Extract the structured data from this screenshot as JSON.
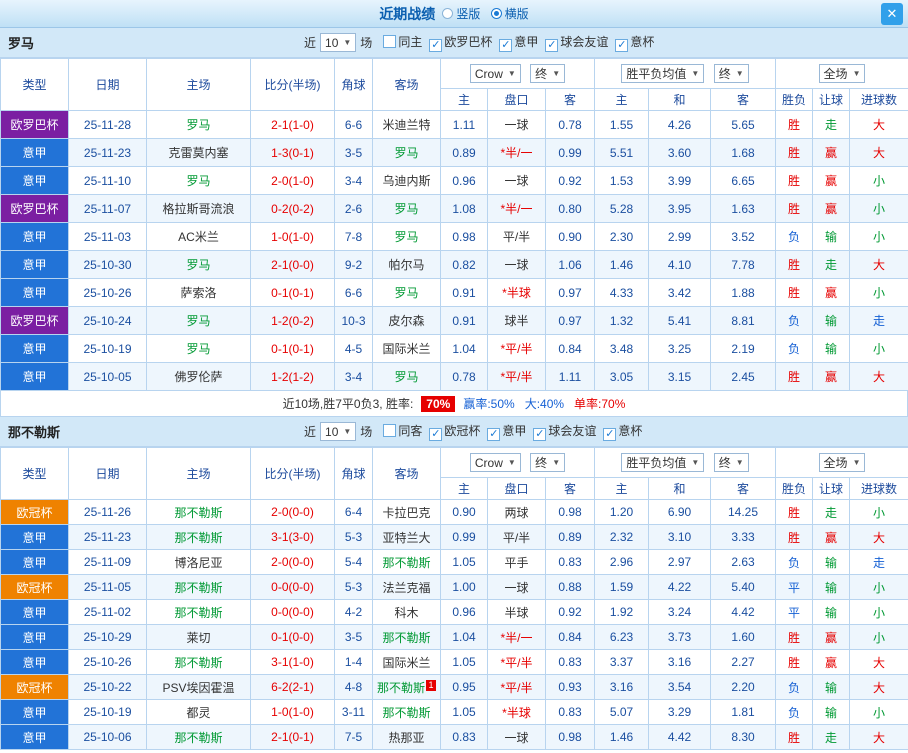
{
  "icons": {
    "dropdown_arrow": "▼",
    "check": "✓",
    "close": "✕"
  },
  "titlebar": {
    "title": "近期战绩",
    "radio_options": [
      {
        "label": "竖版",
        "selected": false
      },
      {
        "label": "横版",
        "selected": true
      }
    ]
  },
  "table_header": {
    "type": "类型",
    "date": "日期",
    "home": "主场",
    "score": "比分(半场)",
    "corner": "角球",
    "away": "客场",
    "odds_source_select": "Crow",
    "odds_time_select": "终",
    "odds_subs": [
      "主",
      "盘口",
      "客"
    ],
    "europe_select": "胜平负均值",
    "europe_time_select": "终",
    "europe_subs": [
      "主",
      "和",
      "客"
    ],
    "result_select": "全场",
    "result_subs": [
      "胜负",
      "让球",
      "进球数"
    ]
  },
  "type_colors": {
    "purple": "#7b1fa2",
    "blue": "#2273d7",
    "orange": "#ef8200"
  },
  "status_colors": {
    "red": "#e60000",
    "green": "#009933",
    "blue": "#1560d4"
  },
  "sections": [
    {
      "team": "罗马",
      "near_label": "近",
      "count_select": "10",
      "count_suffix": "场",
      "filters": [
        {
          "label": "同主",
          "checked": false
        },
        {
          "label": "欧罗巴杯",
          "checked": true
        },
        {
          "label": "意甲",
          "checked": true
        },
        {
          "label": "球会友谊",
          "checked": true
        },
        {
          "label": "意杯",
          "checked": true
        }
      ],
      "rows": [
        {
          "type": "欧罗巴杯",
          "type_color": "purple",
          "date": "25-11-28",
          "home": "罗马",
          "home_subject": true,
          "score": "2-1(1-0)",
          "corner": "6-6",
          "away": "米迪兰特",
          "odds_home": "1.11",
          "handicap": "一球",
          "handicap_red": false,
          "odds_away": "0.78",
          "eu_home": "1.55",
          "eu_draw": "4.26",
          "eu_away": "5.65",
          "results": [
            [
              "胜",
              "red"
            ],
            [
              "走",
              "green"
            ],
            [
              "大",
              "red"
            ]
          ]
        },
        {
          "type": "意甲",
          "type_color": "blue",
          "date": "25-11-23",
          "home": "克雷莫内塞",
          "score": "1-3(0-1)",
          "corner": "3-5",
          "away": "罗马",
          "away_subject": true,
          "odds_home": "0.89",
          "handicap": "*半/一",
          "handicap_red": true,
          "odds_away": "0.99",
          "eu_home": "5.51",
          "eu_draw": "3.60",
          "eu_away": "1.68",
          "results": [
            [
              "胜",
              "red"
            ],
            [
              "赢",
              "red"
            ],
            [
              "大",
              "red"
            ]
          ]
        },
        {
          "type": "意甲",
          "type_color": "blue",
          "date": "25-11-10",
          "home": "罗马",
          "home_subject": true,
          "score": "2-0(1-0)",
          "corner": "3-4",
          "away": "乌迪内斯",
          "odds_home": "0.96",
          "handicap": "一球",
          "handicap_red": false,
          "odds_away": "0.92",
          "eu_home": "1.53",
          "eu_draw": "3.99",
          "eu_away": "6.65",
          "results": [
            [
              "胜",
              "red"
            ],
            [
              "赢",
              "red"
            ],
            [
              "小",
              "green"
            ]
          ]
        },
        {
          "type": "欧罗巴杯",
          "type_color": "purple",
          "date": "25-11-07",
          "home": "格拉斯哥流浪",
          "score": "0-2(0-2)",
          "corner": "2-6",
          "away": "罗马",
          "away_subject": true,
          "odds_home": "1.08",
          "handicap": "*半/一",
          "handicap_red": true,
          "odds_away": "0.80",
          "eu_home": "5.28",
          "eu_draw": "3.95",
          "eu_away": "1.63",
          "results": [
            [
              "胜",
              "red"
            ],
            [
              "赢",
              "red"
            ],
            [
              "小",
              "green"
            ]
          ]
        },
        {
          "type": "意甲",
          "type_color": "blue",
          "date": "25-11-03",
          "home": "AC米兰",
          "score": "1-0(1-0)",
          "corner": "7-8",
          "away": "罗马",
          "away_subject": true,
          "odds_home": "0.98",
          "handicap": "平/半",
          "handicap_red": false,
          "odds_away": "0.90",
          "eu_home": "2.30",
          "eu_draw": "2.99",
          "eu_away": "3.52",
          "results": [
            [
              "负",
              "blue"
            ],
            [
              "输",
              "green"
            ],
            [
              "小",
              "green"
            ]
          ]
        },
        {
          "type": "意甲",
          "type_color": "blue",
          "date": "25-10-30",
          "home": "罗马",
          "home_subject": true,
          "score": "2-1(0-0)",
          "corner": "9-2",
          "away": "帕尔马",
          "odds_home": "0.82",
          "handicap": "一球",
          "handicap_red": false,
          "odds_away": "1.06",
          "eu_home": "1.46",
          "eu_draw": "4.10",
          "eu_away": "7.78",
          "results": [
            [
              "胜",
              "red"
            ],
            [
              "走",
              "green"
            ],
            [
              "大",
              "red"
            ]
          ]
        },
        {
          "type": "意甲",
          "type_color": "blue",
          "date": "25-10-26",
          "home": "萨索洛",
          "score": "0-1(0-1)",
          "corner": "6-6",
          "away": "罗马",
          "away_subject": true,
          "odds_home": "0.91",
          "handicap": "*半球",
          "handicap_red": true,
          "odds_away": "0.97",
          "eu_home": "4.33",
          "eu_draw": "3.42",
          "eu_away": "1.88",
          "results": [
            [
              "胜",
              "red"
            ],
            [
              "赢",
              "red"
            ],
            [
              "小",
              "green"
            ]
          ]
        },
        {
          "type": "欧罗巴杯",
          "type_color": "purple",
          "date": "25-10-24",
          "home": "罗马",
          "home_subject": true,
          "score": "1-2(0-2)",
          "corner": "10-3",
          "away": "皮尔森",
          "odds_home": "0.91",
          "handicap": "球半",
          "handicap_red": false,
          "odds_away": "0.97",
          "eu_home": "1.32",
          "eu_draw": "5.41",
          "eu_away": "8.81",
          "results": [
            [
              "负",
              "blue"
            ],
            [
              "输",
              "green"
            ],
            [
              "走",
              "blue"
            ]
          ]
        },
        {
          "type": "意甲",
          "type_color": "blue",
          "date": "25-10-19",
          "home": "罗马",
          "home_subject": true,
          "score": "0-1(0-1)",
          "corner": "4-5",
          "away": "国际米兰",
          "odds_home": "1.04",
          "handicap": "*平/半",
          "handicap_red": true,
          "odds_away": "0.84",
          "eu_home": "3.48",
          "eu_draw": "3.25",
          "eu_away": "2.19",
          "results": [
            [
              "负",
              "blue"
            ],
            [
              "输",
              "green"
            ],
            [
              "小",
              "green"
            ]
          ]
        },
        {
          "type": "意甲",
          "type_color": "blue",
          "date": "25-10-05",
          "home": "佛罗伦萨",
          "score": "1-2(1-2)",
          "corner": "3-4",
          "away": "罗马",
          "away_subject": true,
          "odds_home": "0.78",
          "handicap": "*平/半",
          "handicap_red": true,
          "odds_away": "1.11",
          "eu_home": "3.05",
          "eu_draw": "3.15",
          "eu_away": "2.45",
          "results": [
            [
              "胜",
              "red"
            ],
            [
              "赢",
              "red"
            ],
            [
              "大",
              "red"
            ]
          ]
        }
      ],
      "summary": {
        "prefix": "近10场,胜7平0负3, 胜率:",
        "win_rate": "70%",
        "stats": [
          {
            "text": "赢率:50%",
            "color": "blue"
          },
          {
            "text": "大:40%",
            "color": "blue"
          },
          {
            "text": "单率:70%",
            "color": "red"
          }
        ]
      }
    },
    {
      "team": "那不勒斯",
      "near_label": "近",
      "count_select": "10",
      "count_suffix": "场",
      "filters": [
        {
          "label": "同客",
          "checked": false
        },
        {
          "label": "欧冠杯",
          "checked": true
        },
        {
          "label": "意甲",
          "checked": true
        },
        {
          "label": "球会友谊",
          "checked": true
        },
        {
          "label": "意杯",
          "checked": true
        }
      ],
      "rows": [
        {
          "type": "欧冠杯",
          "type_color": "orange",
          "date": "25-11-26",
          "home": "那不勒斯",
          "home_subject": true,
          "score": "2-0(0-0)",
          "corner": "6-4",
          "away": "卡拉巴克",
          "odds_home": "0.90",
          "handicap": "两球",
          "handicap_red": false,
          "odds_away": "0.98",
          "eu_home": "1.20",
          "eu_draw": "6.90",
          "eu_away": "14.25",
          "results": [
            [
              "胜",
              "red"
            ],
            [
              "走",
              "green"
            ],
            [
              "小",
              "green"
            ]
          ]
        },
        {
          "type": "意甲",
          "type_color": "blue",
          "date": "25-11-23",
          "home": "那不勒斯",
          "home_subject": true,
          "score": "3-1(3-0)",
          "corner": "5-3",
          "away": "亚特兰大",
          "odds_home": "0.99",
          "handicap": "平/半",
          "handicap_red": false,
          "odds_away": "0.89",
          "eu_home": "2.32",
          "eu_draw": "3.10",
          "eu_away": "3.33",
          "results": [
            [
              "胜",
              "red"
            ],
            [
              "赢",
              "red"
            ],
            [
              "大",
              "red"
            ]
          ]
        },
        {
          "type": "意甲",
          "type_color": "blue",
          "date": "25-11-09",
          "home": "博洛尼亚",
          "score": "2-0(0-0)",
          "corner": "5-4",
          "away": "那不勒斯",
          "away_subject": true,
          "odds_home": "1.05",
          "handicap": "平手",
          "handicap_red": false,
          "odds_away": "0.83",
          "eu_home": "2.96",
          "eu_draw": "2.97",
          "eu_away": "2.63",
          "results": [
            [
              "负",
              "blue"
            ],
            [
              "输",
              "green"
            ],
            [
              "走",
              "blue"
            ]
          ]
        },
        {
          "type": "欧冠杯",
          "type_color": "orange",
          "date": "25-11-05",
          "home": "那不勒斯",
          "home_subject": true,
          "score": "0-0(0-0)",
          "corner": "5-3",
          "away": "法兰克福",
          "odds_home": "1.00",
          "handicap": "一球",
          "handicap_red": false,
          "odds_away": "0.88",
          "eu_home": "1.59",
          "eu_draw": "4.22",
          "eu_away": "5.40",
          "results": [
            [
              "平",
              "blue"
            ],
            [
              "输",
              "green"
            ],
            [
              "小",
              "green"
            ]
          ]
        },
        {
          "type": "意甲",
          "type_color": "blue",
          "date": "25-11-02",
          "home": "那不勒斯",
          "home_subject": true,
          "score": "0-0(0-0)",
          "corner": "4-2",
          "away": "科木",
          "odds_home": "0.96",
          "handicap": "半球",
          "handicap_red": false,
          "odds_away": "0.92",
          "eu_home": "1.92",
          "eu_draw": "3.24",
          "eu_away": "4.42",
          "results": [
            [
              "平",
              "blue"
            ],
            [
              "输",
              "green"
            ],
            [
              "小",
              "green"
            ]
          ]
        },
        {
          "type": "意甲",
          "type_color": "blue",
          "date": "25-10-29",
          "home": "莱切",
          "score": "0-1(0-0)",
          "corner": "3-5",
          "away": "那不勒斯",
          "away_subject": true,
          "odds_home": "1.04",
          "handicap": "*半/一",
          "handicap_red": true,
          "odds_away": "0.84",
          "eu_home": "6.23",
          "eu_draw": "3.73",
          "eu_away": "1.60",
          "results": [
            [
              "胜",
              "red"
            ],
            [
              "赢",
              "red"
            ],
            [
              "小",
              "green"
            ]
          ]
        },
        {
          "type": "意甲",
          "type_color": "blue",
          "date": "25-10-26",
          "home": "那不勒斯",
          "home_subject": true,
          "score": "3-1(1-0)",
          "corner": "1-4",
          "away": "国际米兰",
          "odds_home": "1.05",
          "handicap": "*平/半",
          "handicap_red": true,
          "odds_away": "0.83",
          "eu_home": "3.37",
          "eu_draw": "3.16",
          "eu_away": "2.27",
          "results": [
            [
              "胜",
              "red"
            ],
            [
              "赢",
              "red"
            ],
            [
              "大",
              "red"
            ]
          ]
        },
        {
          "type": "欧冠杯",
          "type_color": "orange",
          "date": "25-10-22",
          "home": "PSV埃因霍温",
          "score": "6-2(2-1)",
          "corner": "4-8",
          "away": "那不勒斯",
          "away_subject": true,
          "away_badge": "1",
          "odds_home": "0.95",
          "handicap": "*平/半",
          "handicap_red": true,
          "odds_away": "0.93",
          "eu_home": "3.16",
          "eu_draw": "3.54",
          "eu_away": "2.20",
          "results": [
            [
              "负",
              "blue"
            ],
            [
              "输",
              "green"
            ],
            [
              "大",
              "red"
            ]
          ]
        },
        {
          "type": "意甲",
          "type_color": "blue",
          "date": "25-10-19",
          "home": "都灵",
          "score": "1-0(1-0)",
          "corner": "3-11",
          "away": "那不勒斯",
          "away_subject": true,
          "odds_home": "1.05",
          "handicap": "*半球",
          "handicap_red": true,
          "odds_away": "0.83",
          "eu_home": "5.07",
          "eu_draw": "3.29",
          "eu_away": "1.81",
          "results": [
            [
              "负",
              "blue"
            ],
            [
              "输",
              "green"
            ],
            [
              "小",
              "green"
            ]
          ]
        },
        {
          "type": "意甲",
          "type_color": "blue",
          "date": "25-10-06",
          "home": "那不勒斯",
          "home_subject": true,
          "score": "2-1(0-1)",
          "corner": "7-5",
          "away": "热那亚",
          "odds_home": "0.83",
          "handicap": "一球",
          "handicap_red": false,
          "odds_away": "0.98",
          "eu_home": "1.46",
          "eu_draw": "4.42",
          "eu_away": "8.30",
          "results": [
            [
              "胜",
              "red"
            ],
            [
              "走",
              "green"
            ],
            [
              "大",
              "red"
            ]
          ]
        }
      ]
    }
  ]
}
